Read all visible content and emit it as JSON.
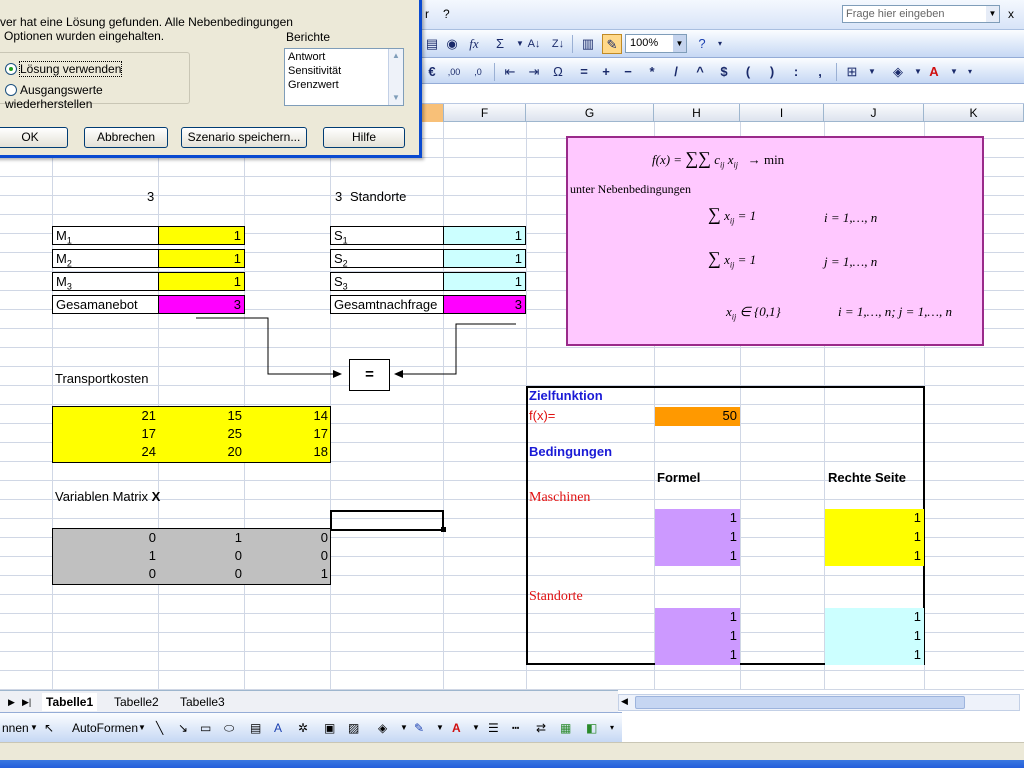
{
  "menu": {
    "fragment": "r",
    "help": "?",
    "close": "x"
  },
  "help_box": {
    "placeholder": "Frage hier eingeben"
  },
  "toolbar": {
    "zoom": "100%",
    "sigma": "Σ",
    "fx": "fx"
  },
  "formatting_symbols": [
    "€",
    "=",
    "+",
    "−",
    "*",
    "/",
    "^",
    "$",
    "(",
    ")",
    ":",
    ","
  ],
  "columns": [
    "F",
    "G",
    "H",
    "I",
    "J",
    "K"
  ],
  "dialog": {
    "message_line1": "ver hat eine Lösung gefunden. Alle Nebenbedingungen",
    "message_line2": "Optionen wurden eingehalten.",
    "reports_label": "Berichte",
    "reports": [
      "Antwort",
      "Sensitivität",
      "Grenzwert"
    ],
    "option_keep": "Lösung verwenden",
    "option_restore": "Ausgangswerte wiederherstellen",
    "ok": "OK",
    "cancel": "Abbrechen",
    "save_scenario": "Szenario speichern...",
    "help": "Hilfe"
  },
  "sheet": {
    "machine_count": "3",
    "site_count": "3",
    "site_label": "Standorte",
    "machines": [
      {
        "label": "M",
        "sub": "1",
        "value": "1"
      },
      {
        "label": "M",
        "sub": "2",
        "value": "1"
      },
      {
        "label": "M",
        "sub": "3",
        "value": "1"
      }
    ],
    "supply_total_label": "Gesamanebot",
    "supply_total": "3",
    "sites": [
      {
        "label": "S",
        "sub": "1",
        "value": "1"
      },
      {
        "label": "S",
        "sub": "2",
        "value": "1"
      },
      {
        "label": "S",
        "sub": "3",
        "value": "1"
      }
    ],
    "demand_total_label": "Gesamtnachfrage",
    "demand_total": "3",
    "equals_sign": "=",
    "transport_label": "Transportkosten",
    "transport_costs": [
      [
        "21",
        "15",
        "14"
      ],
      [
        "17",
        "25",
        "17"
      ],
      [
        "24",
        "20",
        "18"
      ]
    ],
    "matrix_label": "Variablen Matrix",
    "matrix_symbol": "X",
    "matrix": [
      [
        "0",
        "1",
        "0"
      ],
      [
        "1",
        "0",
        "0"
      ],
      [
        "0",
        "0",
        "1"
      ]
    ]
  },
  "model": {
    "objective_header": "Zielfunktion",
    "fx_label": "f(x)=",
    "fx_value": "50",
    "constraints_header": "Bedingungen",
    "formula_header": "Formel",
    "rhs_header": "Rechte Seite",
    "machines_label": "Maschinen",
    "machine_rows": [
      {
        "formula": "1",
        "rhs": "1"
      },
      {
        "formula": "1",
        "rhs": "1"
      },
      {
        "formula": "1",
        "rhs": "1"
      }
    ],
    "sites_label": "Standorte",
    "site_rows": [
      {
        "formula": "1",
        "rhs": "1"
      },
      {
        "formula": "1",
        "rhs": "1"
      },
      {
        "formula": "1",
        "rhs": "1"
      }
    ]
  },
  "formula_box": {
    "objective": "f(x) = ",
    "objective_term": "c",
    "objective_arrow": "→   min",
    "subject_to": "unter Nebenbedingungen",
    "constraint1": "= 1",
    "constraint1_range": "i = 1,…, n",
    "constraint2": "= 1",
    "constraint2_range": "j = 1,…, n",
    "binary": "x",
    "binary_set": "∈ {0,1}",
    "binary_range": "i = 1,…, n;     j = 1,…, n"
  },
  "tabs": [
    "Tabelle1",
    "Tabelle2",
    "Tabelle3"
  ],
  "drawbar": {
    "fragment": "nnen",
    "autoshapes": "AutoFormen"
  },
  "colors": {
    "yellow": "#ffff00",
    "cyan": "#ccffff",
    "magenta": "#ff00ff",
    "gray": "#c0c0c0",
    "orange": "#ff9900",
    "lilac": "#cc99ff",
    "formula_bg": "#ffc8ff"
  }
}
